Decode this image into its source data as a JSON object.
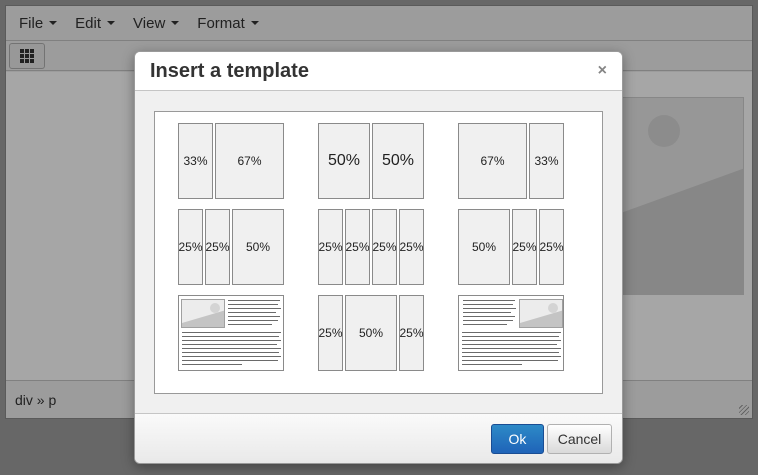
{
  "menubar": {
    "items": [
      {
        "label": "File"
      },
      {
        "label": "Edit"
      },
      {
        "label": "View"
      },
      {
        "label": "Format"
      }
    ]
  },
  "toolbar": {
    "template_button_icon": "grid-icon"
  },
  "statusbar": {
    "path": "div » p"
  },
  "dialog": {
    "title": "Insert a template",
    "close_icon": "×",
    "ok_label": "Ok",
    "cancel_label": "Cancel",
    "templates": [
      {
        "name": "33-67",
        "cells": [
          "33%",
          "67%"
        ]
      },
      {
        "name": "50-50",
        "cells": [
          "50%",
          "50%"
        ]
      },
      {
        "name": "67-33",
        "cells": [
          "67%",
          "33%"
        ]
      },
      {
        "name": "25-25-50",
        "cells": [
          "25%",
          "25%",
          "50%"
        ]
      },
      {
        "name": "25-25-25-25",
        "cells": [
          "25%",
          "25%",
          "25%",
          "25%"
        ]
      },
      {
        "name": "50-25-25",
        "cells": [
          "50%",
          "25%",
          "25%"
        ]
      },
      {
        "name": "image-left-text",
        "cells": []
      },
      {
        "name": "25-50-25",
        "cells": [
          "25%",
          "50%",
          "25%"
        ]
      },
      {
        "name": "image-right-text",
        "cells": []
      }
    ]
  },
  "colors": {
    "ok_button": "#1f63b8",
    "overlay": "#9e9e9e"
  }
}
